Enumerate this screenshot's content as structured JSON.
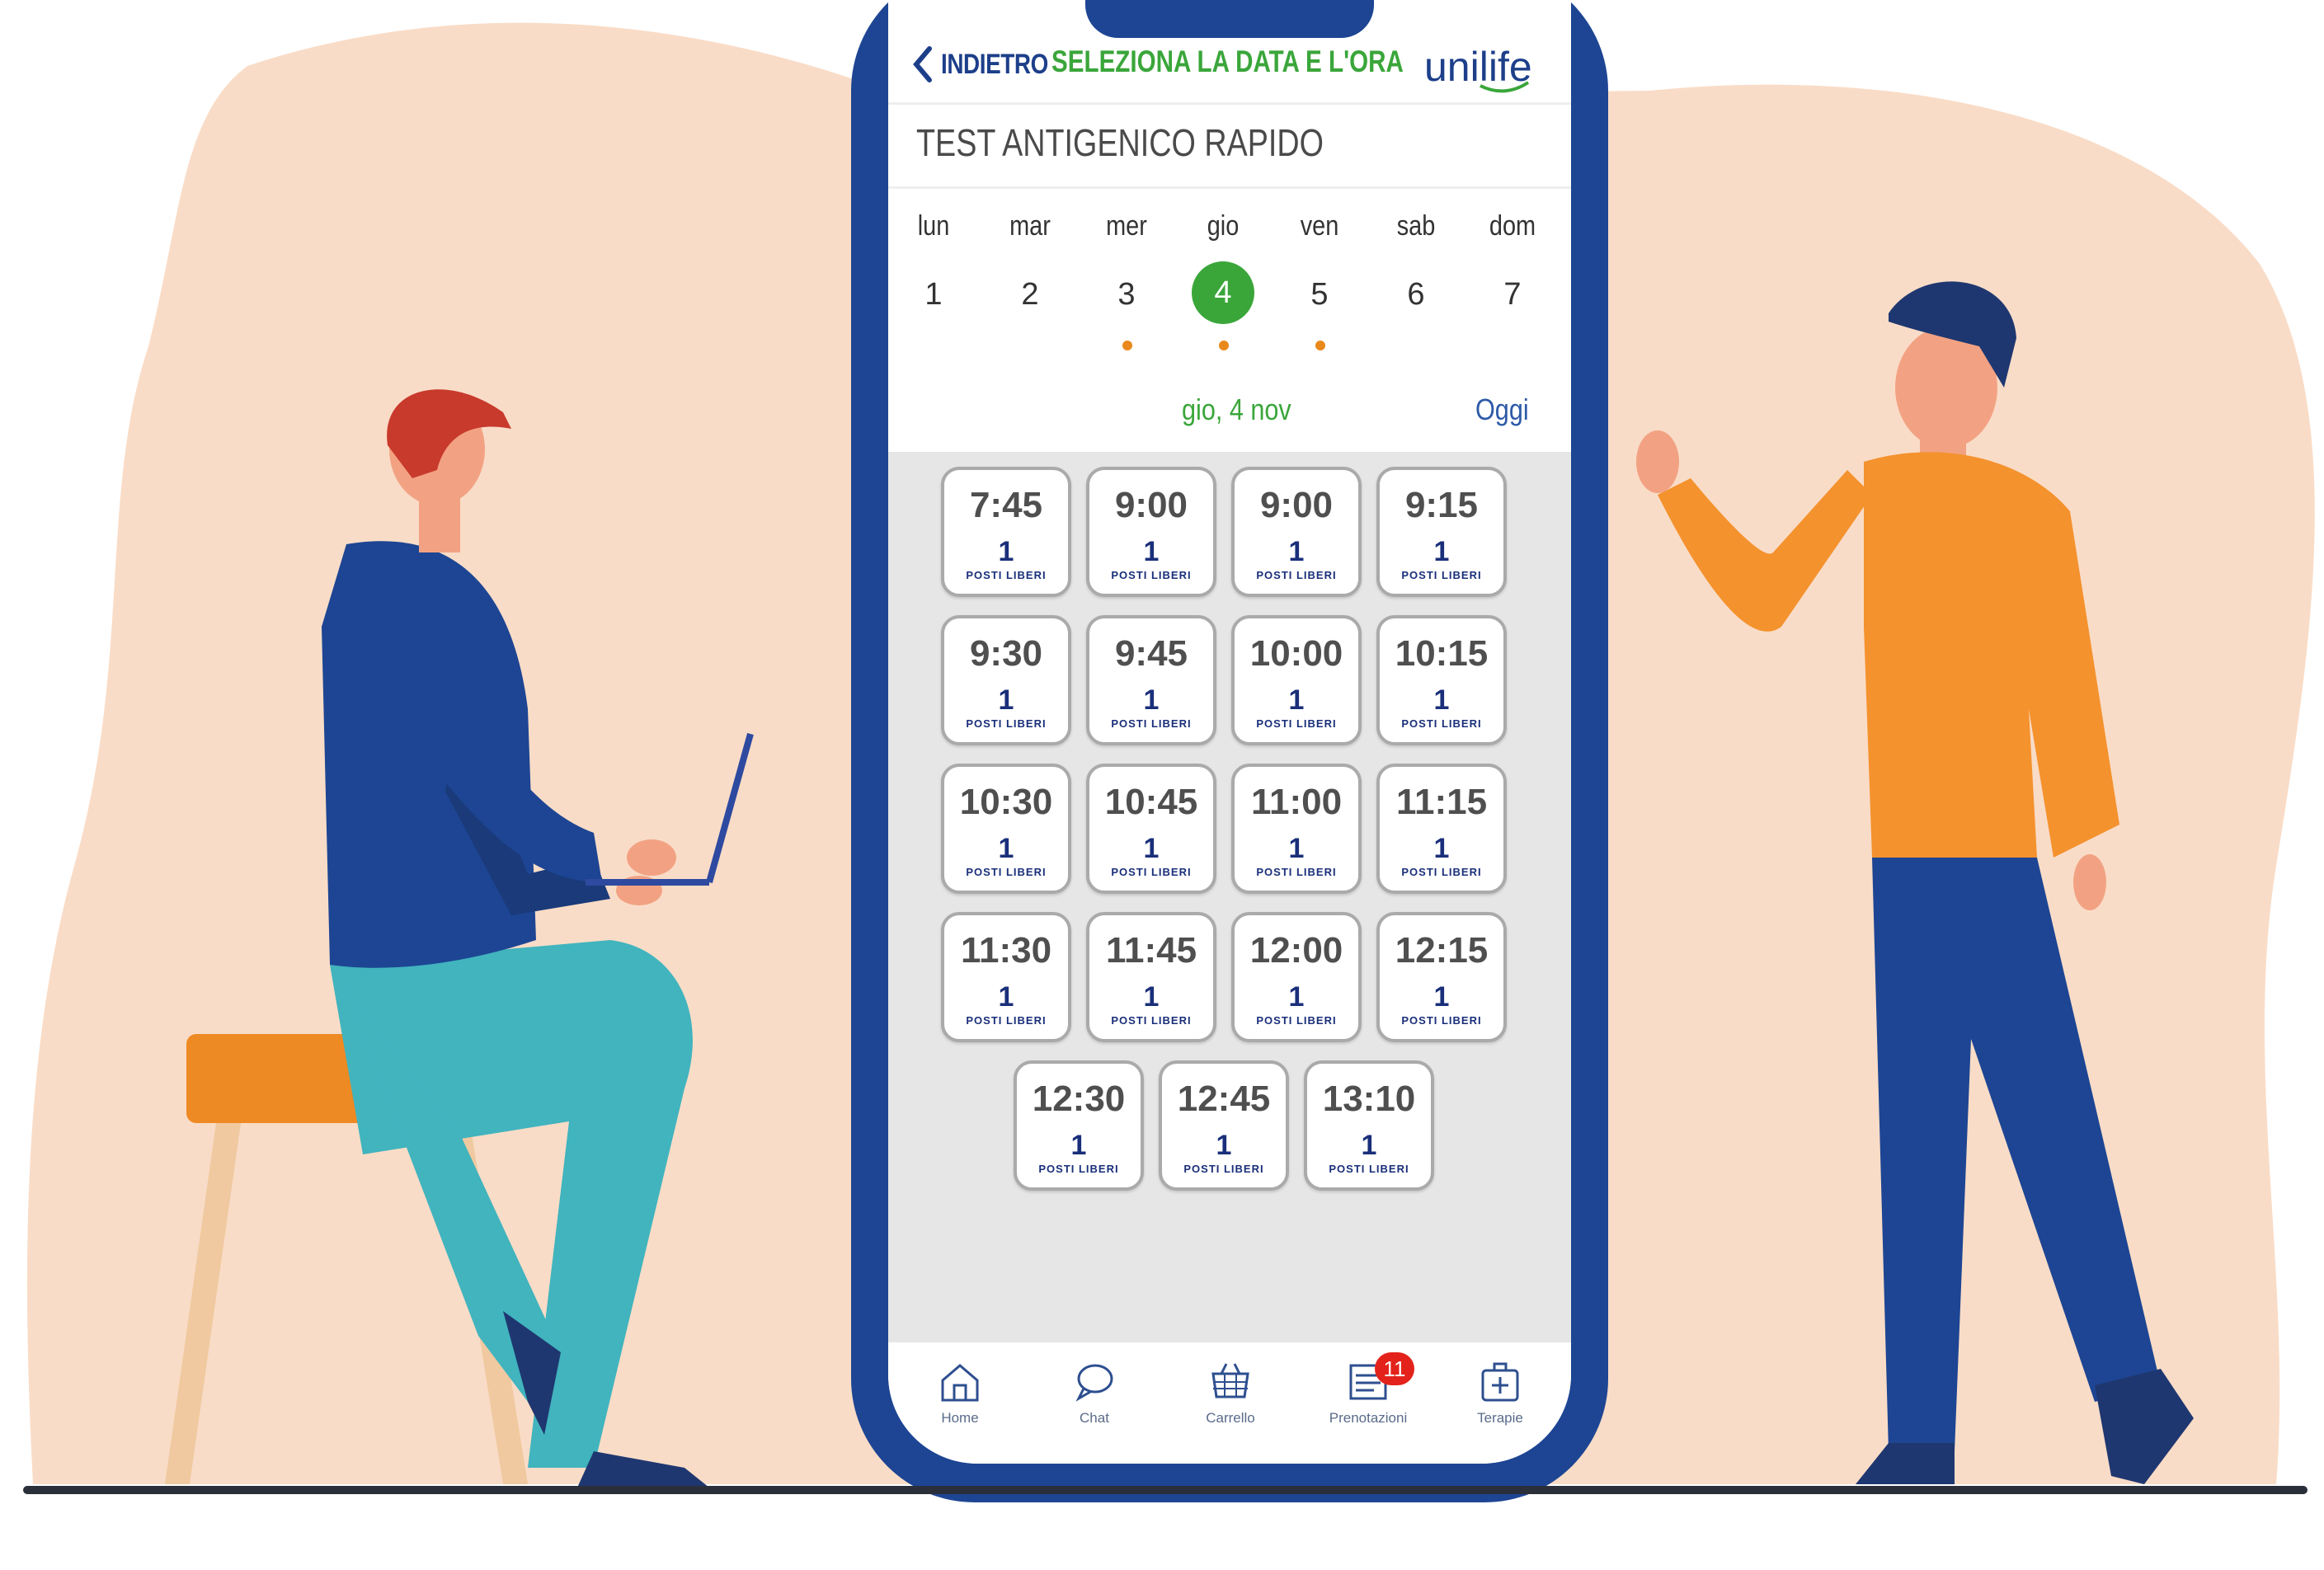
{
  "colors": {
    "background_blob": "#f9dcc7",
    "phone_frame": "#1d4593",
    "accent_green": "#3aa63a",
    "slot_text_blue": "#1a2f7a",
    "dot_orange": "#e9891c",
    "badge_red": "#e3231b"
  },
  "header": {
    "back_label": "INDIETRO",
    "title": "SELEZIONA LA DATA E L'ORA",
    "brand": "unilife"
  },
  "service": {
    "title": "TEST ANTIGENICO RAPIDO"
  },
  "calendar": {
    "days": [
      {
        "name": "lun",
        "num": "1",
        "selected": false,
        "has_slots": false
      },
      {
        "name": "mar",
        "num": "2",
        "selected": false,
        "has_slots": false
      },
      {
        "name": "mer",
        "num": "3",
        "selected": false,
        "has_slots": true
      },
      {
        "name": "gio",
        "num": "4",
        "selected": true,
        "has_slots": true
      },
      {
        "name": "ven",
        "num": "5",
        "selected": false,
        "has_slots": true
      },
      {
        "name": "sab",
        "num": "6",
        "selected": false,
        "has_slots": false
      },
      {
        "name": "dom",
        "num": "7",
        "selected": false,
        "has_slots": false
      }
    ],
    "selected_date": "gio, 4 nov",
    "today_label": "Oggi"
  },
  "slots": [
    {
      "time": "7:45",
      "count": "1",
      "label": "POSTI LIBERI"
    },
    {
      "time": "9:00",
      "count": "1",
      "label": "POSTI LIBERI"
    },
    {
      "time": "9:00",
      "count": "1",
      "label": "POSTI LIBERI"
    },
    {
      "time": "9:15",
      "count": "1",
      "label": "POSTI LIBERI"
    },
    {
      "time": "9:30",
      "count": "1",
      "label": "POSTI LIBERI"
    },
    {
      "time": "9:45",
      "count": "1",
      "label": "POSTI LIBERI"
    },
    {
      "time": "10:00",
      "count": "1",
      "label": "POSTI LIBERI"
    },
    {
      "time": "10:15",
      "count": "1",
      "label": "POSTI LIBERI"
    },
    {
      "time": "10:30",
      "count": "1",
      "label": "POSTI LIBERI"
    },
    {
      "time": "10:45",
      "count": "1",
      "label": "POSTI LIBERI"
    },
    {
      "time": "11:00",
      "count": "1",
      "label": "POSTI LIBERI"
    },
    {
      "time": "11:15",
      "count": "1",
      "label": "POSTI LIBERI"
    },
    {
      "time": "11:30",
      "count": "1",
      "label": "POSTI LIBERI"
    },
    {
      "time": "11:45",
      "count": "1",
      "label": "POSTI LIBERI"
    },
    {
      "time": "12:00",
      "count": "1",
      "label": "POSTI LIBERI"
    },
    {
      "time": "12:15",
      "count": "1",
      "label": "POSTI LIBERI"
    },
    {
      "time": "12:30",
      "count": "1",
      "label": "POSTI LIBERI"
    },
    {
      "time": "12:45",
      "count": "1",
      "label": "POSTI LIBERI"
    },
    {
      "time": "13:10",
      "count": "1",
      "label": "POSTI LIBERI"
    }
  ],
  "tabbar": {
    "items": [
      {
        "label": "Home",
        "icon": "home-icon"
      },
      {
        "label": "Chat",
        "icon": "chat-icon"
      },
      {
        "label": "Carrello",
        "icon": "cart-icon"
      },
      {
        "label": "Prenotazioni",
        "icon": "bookings-icon",
        "badge": "11"
      },
      {
        "label": "Terapie",
        "icon": "medkit-icon"
      }
    ]
  }
}
